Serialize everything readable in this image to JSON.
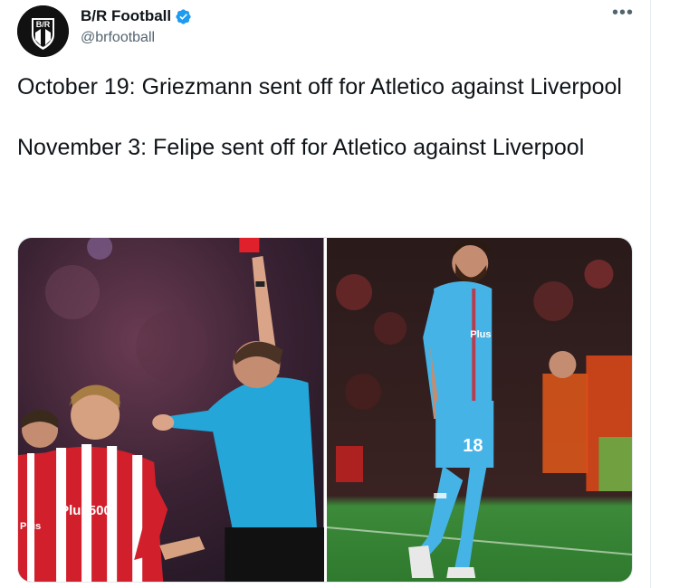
{
  "account": {
    "display_name": "B/R Football",
    "handle": "@brfootball",
    "avatar_text": "B/R",
    "verified_icon": "verified-badge-icon"
  },
  "menu": {
    "more_label": "•••"
  },
  "tweet": {
    "paragraphs": [
      "October 19: Griezmann sent off for Atletico against Liverpool",
      "November 3: Felipe sent off for Atletico against Liverpool"
    ]
  },
  "media": {
    "photos": [
      {
        "shirt_text": "Plus500",
        "shirt_text_2": "Plus"
      },
      {
        "shirt_number": "18",
        "shirt_text": "Plus"
      }
    ]
  },
  "colors": {
    "accent": "#1d9bf0",
    "text": "#0f1419",
    "secondary": "#536471"
  }
}
